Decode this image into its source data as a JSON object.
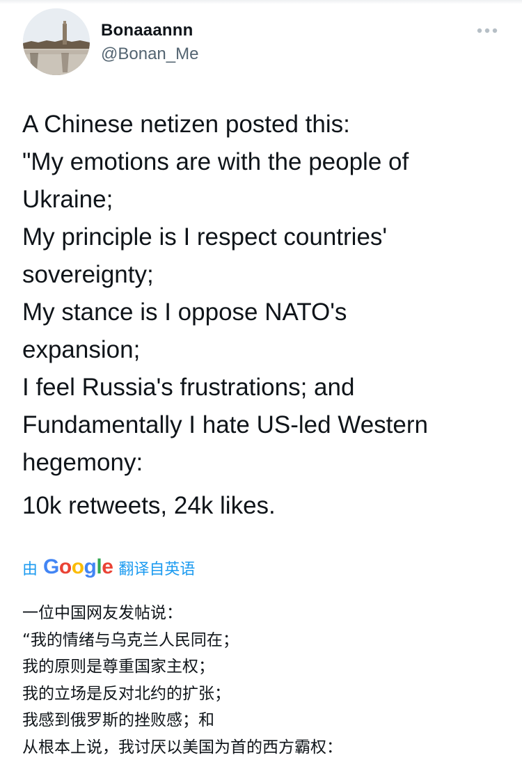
{
  "author": {
    "display_name": "Bonaaannn",
    "handle": "@Bonan_Me",
    "avatar": "avatar-photo"
  },
  "header": {
    "more_icon": "more-horizontal-icon"
  },
  "tweet": {
    "lines": [
      "A Chinese netizen posted this:",
      "\"My emotions are with the people of",
      "Ukraine;",
      "My principle is I respect countries'",
      "sovereignty;",
      "My stance is I oppose NATO's",
      "expansion;",
      "I feel Russia's frustrations; and",
      "Fundamentally I hate US-led Western",
      "hegemony:"
    ],
    "stats": "10k retweets, 24k likes."
  },
  "translation": {
    "prefix": "由",
    "google_letters": [
      "G",
      "o",
      "o",
      "g",
      "l",
      "e"
    ],
    "suffix": "翻译自英语",
    "lines": [
      "一位中国网友发帖说：",
      "“我的情绪与乌克兰人民同在；",
      "我的原则是尊重国家主权；",
      "我的立场是反对北约的扩张；",
      "我感到俄罗斯的挫败感；和",
      "从根本上说，我讨厌以美国为首的西方霸权："
    ]
  },
  "colors": {
    "text": "#0f1419",
    "secondary": "#536471",
    "link_blue": "#1d9bf0",
    "google_blue": "#4285f4",
    "google_red": "#ea4335",
    "google_yellow": "#fbbc05",
    "google_green": "#34a853"
  }
}
